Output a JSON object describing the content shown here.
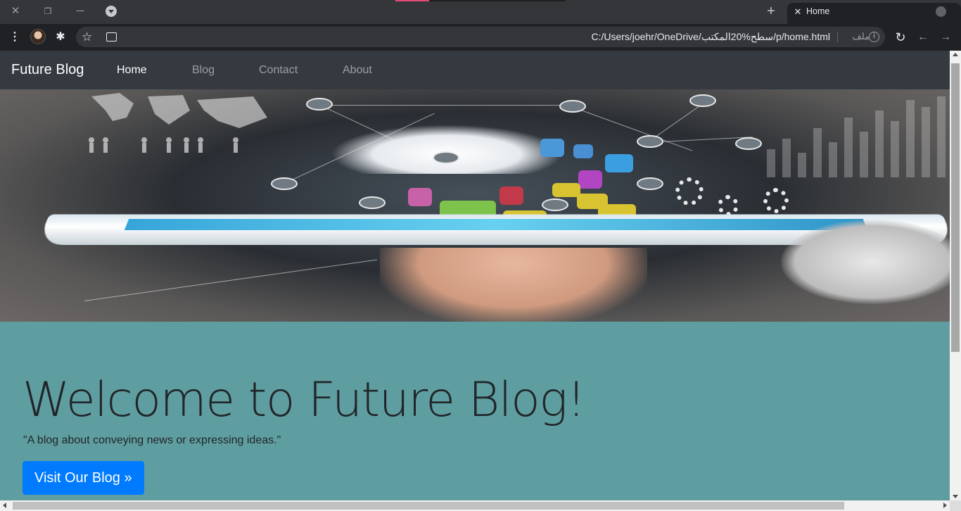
{
  "browser": {
    "tab": {
      "title": "Home"
    },
    "address_bar": {
      "url": "C:/Users/joehr/OneDrive/سطح%20المكتب/p/home.html",
      "scheme_label": "ملف"
    },
    "colors": {
      "frame": "#35363a",
      "toolbar": "#202124",
      "text": "#e8eaed"
    }
  },
  "page": {
    "navbar": {
      "brand": "Future Blog",
      "links": [
        {
          "label": "Home",
          "active": true
        },
        {
          "label": "Blog",
          "active": false
        },
        {
          "label": "Contact",
          "active": false
        },
        {
          "label": "About",
          "active": false
        }
      ]
    },
    "hero": {
      "icon": "hand-tablet-cloud-network-image"
    },
    "jumbotron": {
      "heading": "Welcome to Future Blog!",
      "tagline": "\"A blog about conveying news or expressing ideas.\"",
      "button_label": "Visit Our Blog »"
    },
    "colors": {
      "navbar": "#343a40",
      "jumbotron": "#5f9ea0",
      "button": "#007bff"
    }
  }
}
